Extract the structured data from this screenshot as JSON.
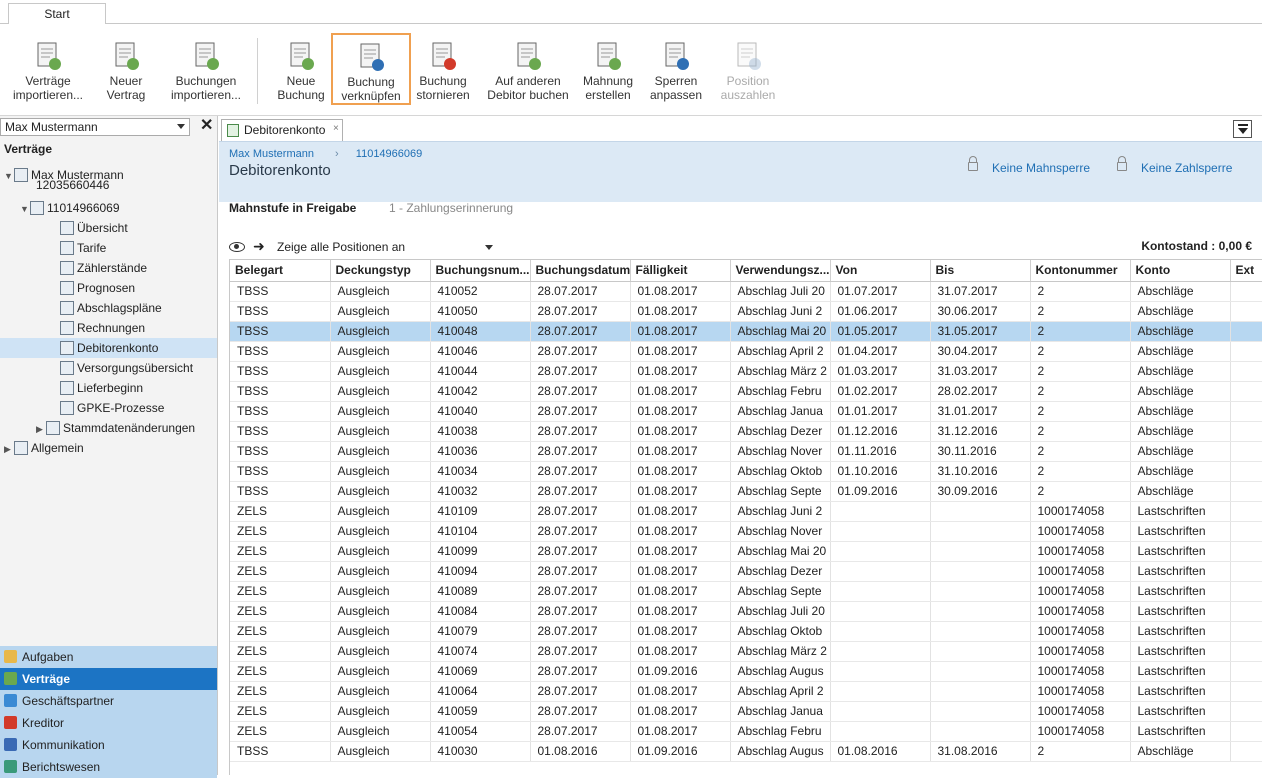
{
  "ribbon": {
    "tab": "Start",
    "buttons": [
      {
        "line1": "Verträge",
        "line2": "importieren..."
      },
      {
        "line1": "Neuer",
        "line2": "Vertrag"
      },
      {
        "line1": "Buchungen",
        "line2": "importieren..."
      },
      {
        "line1": "Neue",
        "line2": "Buchung"
      },
      {
        "line1": "Buchung",
        "line2": "verknüpfen"
      },
      {
        "line1": "Buchung",
        "line2": "stornieren"
      },
      {
        "line1": "Auf anderen",
        "line2": "Debitor buchen"
      },
      {
        "line1": "Mahnung",
        "line2": "erstellen"
      },
      {
        "line1": "Sperren",
        "line2": "anpassen"
      },
      {
        "line1": "Position",
        "line2": "auszahlen"
      }
    ]
  },
  "left": {
    "combo_value": "Max Mustermann",
    "close": "✕",
    "title": "Verträge",
    "tree": [
      "Max Mustermann",
      "12035660446",
      "11014966069",
      "Übersicht",
      "Tarife",
      "Zählerstände",
      "Prognosen",
      "Abschlagspläne",
      "Rechnungen",
      "Debitorenkonto",
      "Versorgungsübersicht",
      "Lieferbeginn",
      "GPKE-Prozesse",
      "Stammdatenänderungen",
      "Allgemein"
    ],
    "nav": [
      "Aufgaben",
      "Verträge",
      "Geschäftspartner",
      "Kreditor",
      "Kommunikation",
      "Berichtswesen"
    ]
  },
  "main": {
    "tab_label": "Debitorenkonto",
    "tab_close": "×",
    "breadcrumb": [
      "Max Mustermann",
      "›",
      "11014966069"
    ],
    "title": "Debitorenkonto",
    "mahnsperre": "Keine Mahnsperre",
    "zahlsperre": "Keine Zahlsperre",
    "mahnstufe_label": "Mahnstufe in Freigabe",
    "mahnstufe_value": "1 - Zahlungserinnerung",
    "filter_text": "Zeige alle Positionen an",
    "filter_arrow": "➜",
    "kontostand": "Kontostand :  0,00 €"
  },
  "table": {
    "columns": [
      "Belegart",
      "Deckungstyp",
      "Buchungsnum...",
      "Buchungsdatum",
      "Fälligkeit",
      "Verwendungsz...",
      "Von",
      "Bis",
      "Kontonummer",
      "Konto",
      "Ext"
    ],
    "rows": [
      [
        "TBSS",
        "Ausgleich",
        "410052",
        "28.07.2017",
        "01.08.2017",
        "Abschlag Juli 20",
        "01.07.2017",
        "31.07.2017",
        "2",
        "Abschläge",
        ""
      ],
      [
        "TBSS",
        "Ausgleich",
        "410050",
        "28.07.2017",
        "01.08.2017",
        "Abschlag Juni 2",
        "01.06.2017",
        "30.06.2017",
        "2",
        "Abschläge",
        ""
      ],
      [
        "TBSS",
        "Ausgleich",
        "410048",
        "28.07.2017",
        "01.08.2017",
        "Abschlag Mai 20",
        "01.05.2017",
        "31.05.2017",
        "2",
        "Abschläge",
        ""
      ],
      [
        "TBSS",
        "Ausgleich",
        "410046",
        "28.07.2017",
        "01.08.2017",
        "Abschlag April 2",
        "01.04.2017",
        "30.04.2017",
        "2",
        "Abschläge",
        ""
      ],
      [
        "TBSS",
        "Ausgleich",
        "410044",
        "28.07.2017",
        "01.08.2017",
        "Abschlag März 2",
        "01.03.2017",
        "31.03.2017",
        "2",
        "Abschläge",
        ""
      ],
      [
        "TBSS",
        "Ausgleich",
        "410042",
        "28.07.2017",
        "01.08.2017",
        "Abschlag Febru",
        "01.02.2017",
        "28.02.2017",
        "2",
        "Abschläge",
        ""
      ],
      [
        "TBSS",
        "Ausgleich",
        "410040",
        "28.07.2017",
        "01.08.2017",
        "Abschlag Janua",
        "01.01.2017",
        "31.01.2017",
        "2",
        "Abschläge",
        ""
      ],
      [
        "TBSS",
        "Ausgleich",
        "410038",
        "28.07.2017",
        "01.08.2017",
        "Abschlag Dezer",
        "01.12.2016",
        "31.12.2016",
        "2",
        "Abschläge",
        ""
      ],
      [
        "TBSS",
        "Ausgleich",
        "410036",
        "28.07.2017",
        "01.08.2017",
        "Abschlag Nover",
        "01.11.2016",
        "30.11.2016",
        "2",
        "Abschläge",
        ""
      ],
      [
        "TBSS",
        "Ausgleich",
        "410034",
        "28.07.2017",
        "01.08.2017",
        "Abschlag Oktob",
        "01.10.2016",
        "31.10.2016",
        "2",
        "Abschläge",
        ""
      ],
      [
        "TBSS",
        "Ausgleich",
        "410032",
        "28.07.2017",
        "01.08.2017",
        "Abschlag Septe",
        "01.09.2016",
        "30.09.2016",
        "2",
        "Abschläge",
        ""
      ],
      [
        "ZELS",
        "Ausgleich",
        "410109",
        "28.07.2017",
        "01.08.2017",
        "Abschlag Juni 2",
        "",
        "",
        "1000174058",
        "Lastschriften",
        ""
      ],
      [
        "ZELS",
        "Ausgleich",
        "410104",
        "28.07.2017",
        "01.08.2017",
        "Abschlag Nover",
        "",
        "",
        "1000174058",
        "Lastschriften",
        ""
      ],
      [
        "ZELS",
        "Ausgleich",
        "410099",
        "28.07.2017",
        "01.08.2017",
        "Abschlag Mai 20",
        "",
        "",
        "1000174058",
        "Lastschriften",
        ""
      ],
      [
        "ZELS",
        "Ausgleich",
        "410094",
        "28.07.2017",
        "01.08.2017",
        "Abschlag Dezer",
        "",
        "",
        "1000174058",
        "Lastschriften",
        ""
      ],
      [
        "ZELS",
        "Ausgleich",
        "410089",
        "28.07.2017",
        "01.08.2017",
        "Abschlag Septe",
        "",
        "",
        "1000174058",
        "Lastschriften",
        ""
      ],
      [
        "ZELS",
        "Ausgleich",
        "410084",
        "28.07.2017",
        "01.08.2017",
        "Abschlag Juli 20",
        "",
        "",
        "1000174058",
        "Lastschriften",
        ""
      ],
      [
        "ZELS",
        "Ausgleich",
        "410079",
        "28.07.2017",
        "01.08.2017",
        "Abschlag Oktob",
        "",
        "",
        "1000174058",
        "Lastschriften",
        ""
      ],
      [
        "ZELS",
        "Ausgleich",
        "410074",
        "28.07.2017",
        "01.08.2017",
        "Abschlag März 2",
        "",
        "",
        "1000174058",
        "Lastschriften",
        ""
      ],
      [
        "ZELS",
        "Ausgleich",
        "410069",
        "28.07.2017",
        "01.09.2016",
        "Abschlag Augus",
        "",
        "",
        "1000174058",
        "Lastschriften",
        ""
      ],
      [
        "ZELS",
        "Ausgleich",
        "410064",
        "28.07.2017",
        "01.08.2017",
        "Abschlag April 2",
        "",
        "",
        "1000174058",
        "Lastschriften",
        ""
      ],
      [
        "ZELS",
        "Ausgleich",
        "410059",
        "28.07.2017",
        "01.08.2017",
        "Abschlag Janua",
        "",
        "",
        "1000174058",
        "Lastschriften",
        ""
      ],
      [
        "ZELS",
        "Ausgleich",
        "410054",
        "28.07.2017",
        "01.08.2017",
        "Abschlag Febru",
        "",
        "",
        "1000174058",
        "Lastschriften",
        ""
      ],
      [
        "TBSS",
        "Ausgleich",
        "410030",
        "01.08.2016",
        "01.09.2016",
        "Abschlag Augus",
        "01.08.2016",
        "31.08.2016",
        "2",
        "Abschläge",
        ""
      ]
    ],
    "selected_row": 2
  },
  "colors": {
    "accent": "#1c74c4",
    "selection": "#b7d7f1",
    "header_band": "#dce9f5",
    "nav": "#b8d6ef",
    "highlight_border": "#f0a050"
  }
}
